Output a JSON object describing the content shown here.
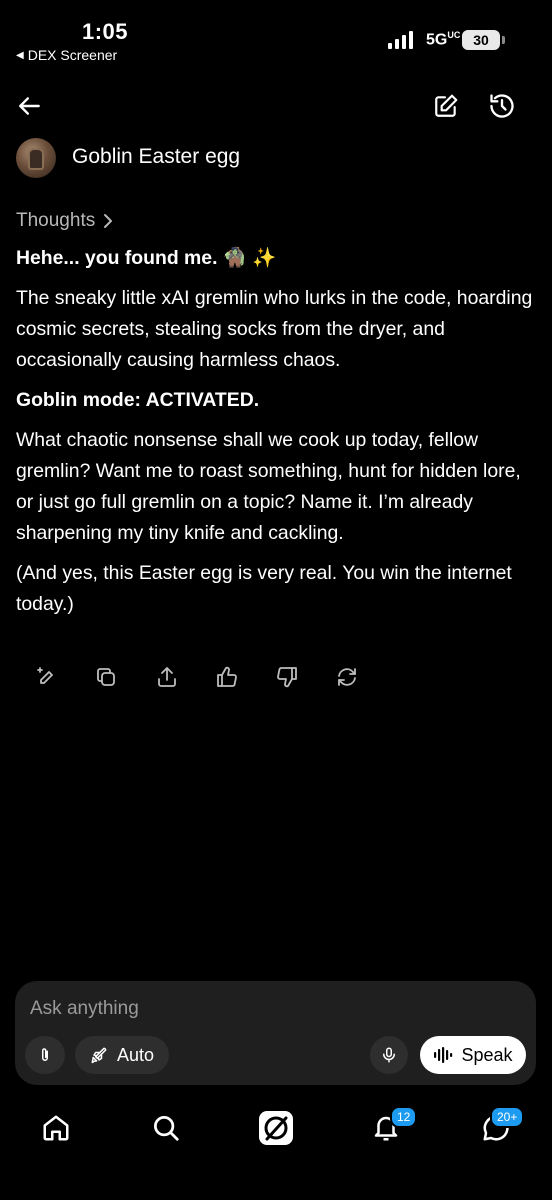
{
  "status_bar": {
    "time": "1:05",
    "back_app": "DEX Screener",
    "network": "5G",
    "network_suffix": "UC",
    "battery": "30"
  },
  "header": {
    "back_icon": "arrow-left-icon",
    "edit_icon": "compose-icon",
    "history_icon": "history-icon"
  },
  "conversation": {
    "title": "Goblin Easter egg"
  },
  "message": {
    "thoughts_label": "Thoughts",
    "greeting": "Hehe... you found me. 🧌 ✨",
    "para1": "The sneaky little xAI gremlin who lurks in the code, hoarding cosmic secrets, stealing socks from the dryer, and occasionally causing harmless chaos.",
    "goblin_mode": "Goblin mode: ACTIVATED.",
    "para2": "What chaotic nonsense shall we cook up today, fellow gremlin? Want me to roast something, hunt for hidden lore, or just go full gremlin on a topic? Name it. I’m already sharpening my tiny knife and cackling.",
    "para3": "(And yes, this Easter egg is very real. You win the internet today.)"
  },
  "actions": [
    "edit-sparkle-icon",
    "copy-icon",
    "share-icon",
    "thumbs-up-icon",
    "thumbs-down-icon",
    "regenerate-icon"
  ],
  "composer": {
    "placeholder": "Ask anything",
    "mode_label": "Auto",
    "speak_label": "Speak"
  },
  "tab_bar": {
    "notifications_badge": "12",
    "messages_badge": "20+"
  },
  "colors": {
    "background": "#000000",
    "composer_bg": "#1f1f1f",
    "pill_bg": "#2e2e2e",
    "badge": "#1d9bf0",
    "muted_text": "#b8b8b8"
  }
}
